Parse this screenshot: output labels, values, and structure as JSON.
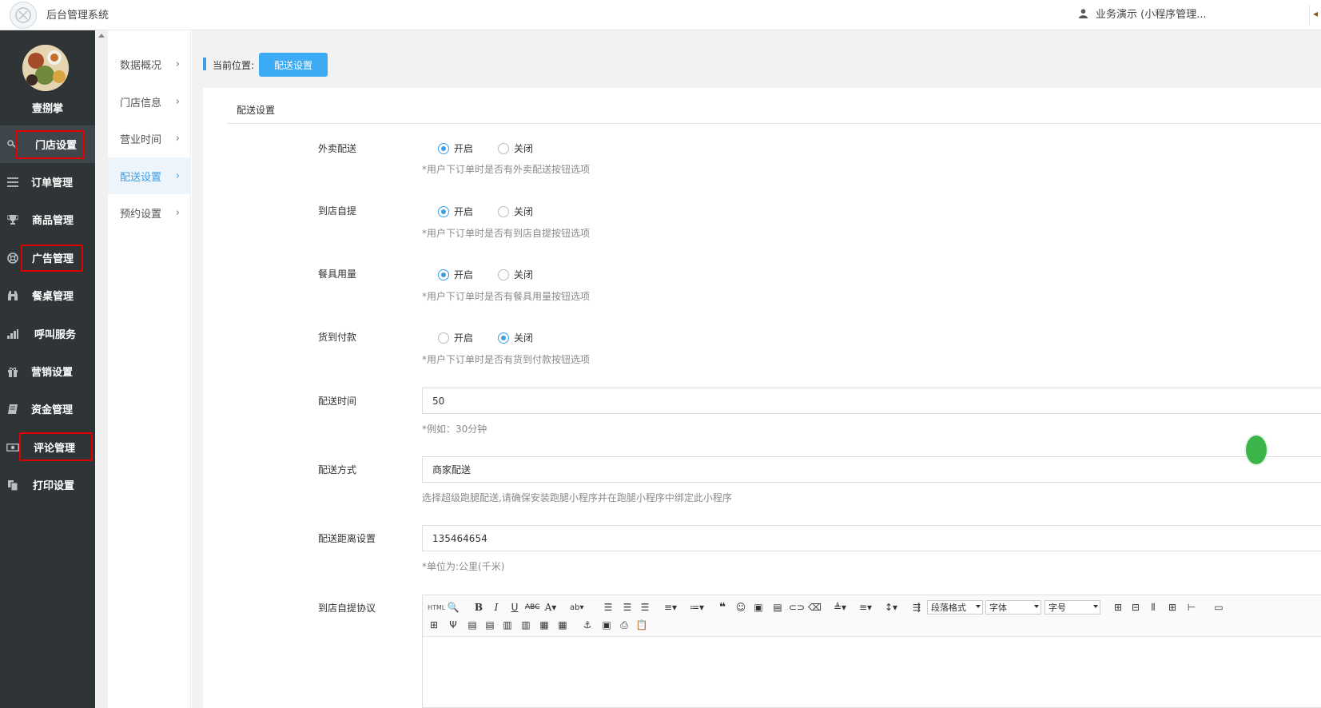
{
  "header": {
    "app_title": "后台管理系统",
    "user_label": "业务演示 (小程序管理...",
    "user_icon": "user-icon"
  },
  "sidebar": {
    "shop_name": "壹捌掌",
    "items": [
      {
        "label": "门店设置",
        "icon": "key-icon"
      },
      {
        "label": "订单管理",
        "icon": "list-icon"
      },
      {
        "label": "商品管理",
        "icon": "trophy-icon"
      },
      {
        "label": "广告管理",
        "icon": "lifebuoy-icon"
      },
      {
        "label": "餐桌管理",
        "icon": "binoculars-icon"
      },
      {
        "label": "呼叫服务",
        "icon": "signal-icon"
      },
      {
        "label": "营销设置",
        "icon": "gift-icon"
      },
      {
        "label": "资金管理",
        "icon": "book-icon"
      },
      {
        "label": "评论管理",
        "icon": "money-icon"
      },
      {
        "label": "打印设置",
        "icon": "copy-icon"
      }
    ]
  },
  "subnav": {
    "items": [
      {
        "label": "数据概况"
      },
      {
        "label": "门店信息"
      },
      {
        "label": "营业时间"
      },
      {
        "label": "配送设置",
        "active": true
      },
      {
        "label": "预约设置"
      }
    ]
  },
  "breadcrumb": {
    "label": "当前位置:",
    "current": "配送设置"
  },
  "form": {
    "title": "配送设置",
    "on_label": "开启",
    "off_label": "关闭",
    "takeout": {
      "label": "外卖配送",
      "value": "开启",
      "hint": "*用户下订单时是否有外卖配送按钮选项"
    },
    "pickup": {
      "label": "到店自提",
      "value": "开启",
      "hint": "*用户下订单时是否有到店自提按钮选项"
    },
    "tableware": {
      "label": "餐具用量",
      "value": "开启",
      "hint": "*用户下订单时是否有餐具用量按钮选项"
    },
    "cod": {
      "label": "货到付款",
      "value": "关闭",
      "hint": "*用户下订单时是否有货到付款按钮选项"
    },
    "delivery_time": {
      "label": "配送时间",
      "value": "50",
      "hint": "*例如：30分钟"
    },
    "delivery_method": {
      "label": "配送方式",
      "value": "商家配送",
      "hint": "选择超级跑腿配送,请确保安装跑腿小程序并在跑腿小程序中绑定此小程序"
    },
    "delivery_distance": {
      "label": "配送距离设置",
      "value": "135464654",
      "hint": "*单位为:公里(千米)"
    },
    "pickup_agreement": {
      "label": "到店自提协议"
    }
  },
  "editor": {
    "html_label": "HTML",
    "paragraph_format": "段落格式",
    "font_family": "字体",
    "font_size": "字号"
  }
}
